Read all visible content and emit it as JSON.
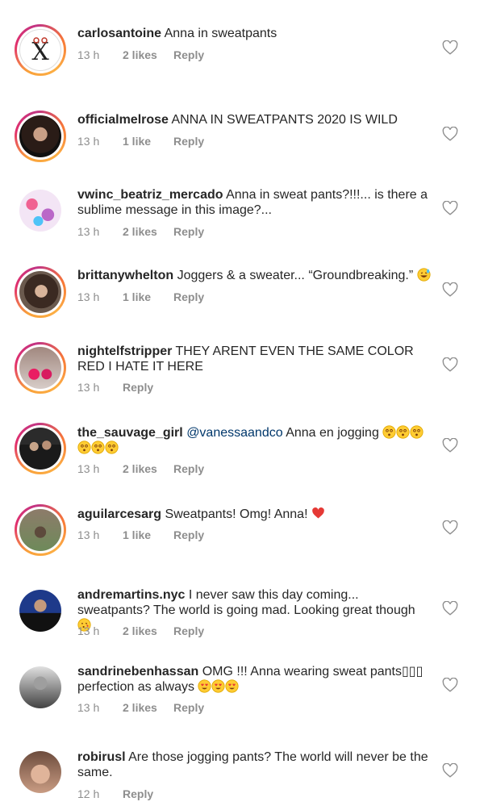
{
  "comments": [
    {
      "username": "carlosantoine",
      "mention": "",
      "text": "Anna in sweatpants",
      "time": "13 h",
      "likes": "2 likes",
      "reply": "Reply",
      "avatar": "scissors-logo-avatar"
    },
    {
      "username": "officialmelrose",
      "mention": "",
      "text": "ANNA IN SWEATPANTS 2020 IS WILD",
      "time": "13 h",
      "likes": "1 like",
      "reply": "Reply",
      "avatar": "woman-dark-hair-avatar"
    },
    {
      "username": "vwinc_beatriz_mercado",
      "mention": "",
      "text": "Anna in sweat pants?!!!... is there a sublime message in this image?...",
      "time": "13 h",
      "likes": "2 likes",
      "reply": "Reply",
      "avatar": "flowers-avatar"
    },
    {
      "username": "brittanywhelton",
      "mention": "",
      "text": "Joggers & a sweater... “Groundbreaking.”",
      "time": "13 h",
      "likes": "1 like",
      "reply": "Reply",
      "avatar": "woman-selfie-avatar",
      "emoji": [
        "grinning-sweat-emoji"
      ]
    },
    {
      "username": "nightelfstripper",
      "mention": "",
      "text": "THEY ARENT EVEN THE SAME COLOR RED I HATE IT HERE",
      "time": "13 h",
      "likes": "",
      "reply": "Reply",
      "avatar": "pink-party-avatar"
    },
    {
      "username": "the_sauvage_girl",
      "mention": "@vanessaandco",
      "text": "Anna en jogging",
      "time": "13 h",
      "likes": "2 likes",
      "reply": "Reply",
      "avatar": "couple-avatar",
      "emoji": [
        "dizzy-face-emoji",
        "dizzy-face-emoji",
        "dizzy-face-emoji",
        "dizzy-face-emoji",
        "dizzy-face-emoji",
        "dizzy-face-emoji"
      ]
    },
    {
      "username": "aguilarcesarg",
      "mention": "",
      "text": "Sweatpants! Omg! Anna!",
      "time": "13 h",
      "likes": "1 like",
      "reply": "Reply",
      "avatar": "man-outdoors-avatar",
      "emoji": [
        "red-heart-emoji"
      ]
    },
    {
      "username": "andremartins.nyc",
      "mention": "",
      "text": "I never saw this day coming... sweatpants? The world is going mad. Looking great though",
      "time": "13 h",
      "likes": "2 likes",
      "reply": "Reply",
      "avatar": "man-suit-avatar",
      "emoji": [
        "kissing-heart-emoji"
      ]
    },
    {
      "username": "sandrinebenhassan",
      "mention": "",
      "text": "OMG !!! Anna wearing sweat pants▯▯▯ perfection as always",
      "time": "13 h",
      "likes": "2 likes",
      "reply": "Reply",
      "avatar": "bw-portrait-avatar",
      "emoji": [
        "heart-eyes-emoji",
        "heart-eyes-emoji",
        "heart-eyes-emoji"
      ]
    },
    {
      "username": "robirusl",
      "mention": "",
      "text": "Are those jogging pants? The world will never be the same.",
      "time": "12 h",
      "likes": "",
      "reply": "Reply",
      "avatar": "woman-face-avatar"
    }
  ],
  "colors": {
    "text": "#262626",
    "meta": "#8e8e8e",
    "mention": "#00376b",
    "ring_start": "#f9a13a",
    "ring_end": "#c13584"
  },
  "icons": {
    "like": "heart-outline-icon"
  }
}
